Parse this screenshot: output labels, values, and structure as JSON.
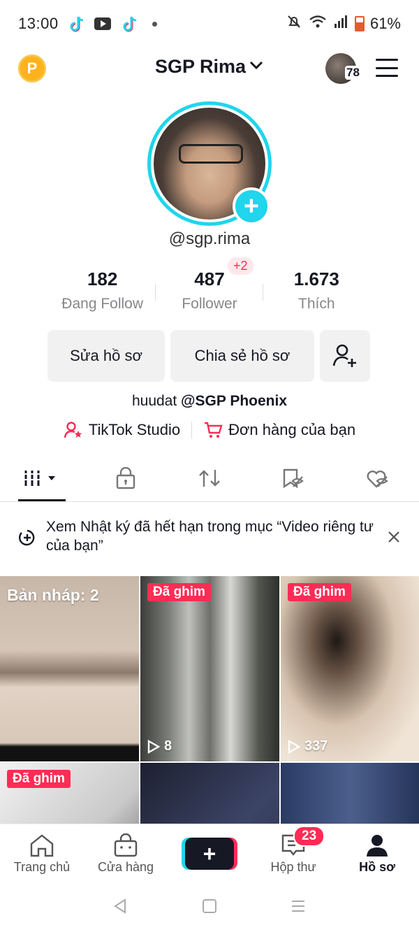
{
  "status_bar": {
    "time": "13:00",
    "battery": "61%"
  },
  "header": {
    "title": "SGP Rima",
    "story_count": "78",
    "coin_letter": "P"
  },
  "profile": {
    "username": "@sgp.rima",
    "stats": [
      {
        "value": "182",
        "label": "Đang Follow"
      },
      {
        "value": "487",
        "label": "Follower"
      },
      {
        "value": "1.673",
        "label": "Thích"
      }
    ],
    "follower_delta": "+2",
    "edit_label": "Sửa hồ sơ",
    "share_label": "Chia sẻ hồ sơ",
    "bio_name": "huudat",
    "bio_mention": "@SGP Phoenix",
    "studio_label": "TikTok Studio",
    "orders_label": "Đơn hàng của bạn"
  },
  "notice": {
    "text": "Xem Nhật ký đã hết hạn trong mục “Video riêng tư của bạn”"
  },
  "grid": {
    "draft_label": "Bản nháp: 2",
    "pin_label": "Đã ghim",
    "videos": [
      {
        "views": "8"
      },
      {
        "views": "337"
      }
    ]
  },
  "bottom_nav": {
    "home": "Trang chủ",
    "shop": "Cửa hàng",
    "inbox": "Hộp thư",
    "inbox_badge": "23",
    "profile": "Hồ sơ"
  },
  "colors": {
    "accent_cyan": "#20d5ec",
    "accent_red": "#fe2c55",
    "text": "#161823",
    "muted": "#86878b"
  }
}
